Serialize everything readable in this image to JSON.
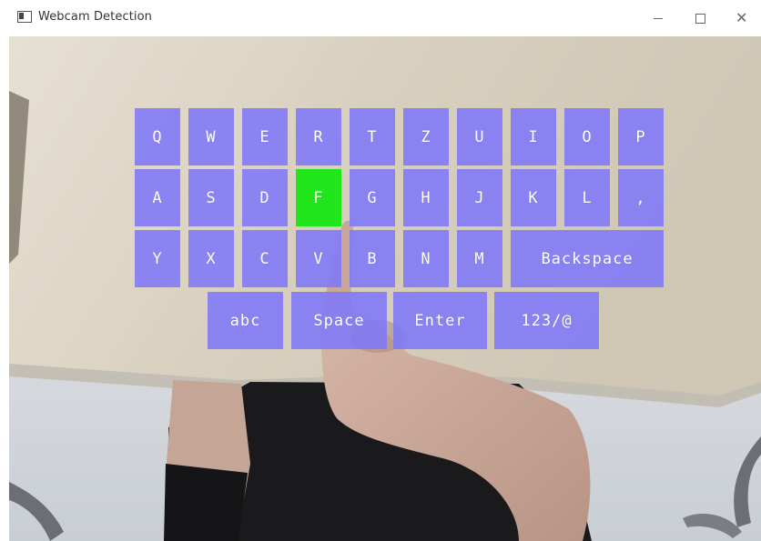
{
  "window": {
    "title": "Webcam Detection",
    "controls": {
      "minimize": "minimize-icon",
      "maximize": "maximize-icon",
      "close": "close-icon"
    }
  },
  "keyboard": {
    "row1": [
      "Q",
      "W",
      "E",
      "R",
      "T",
      "Z",
      "U",
      "I",
      "O",
      "P"
    ],
    "row2": [
      "A",
      "S",
      "D",
      "F",
      "G",
      "H",
      "J",
      "K",
      "L",
      ","
    ],
    "row3": [
      "Y",
      "X",
      "C",
      "V",
      "B",
      "N",
      "M",
      "Backspace"
    ],
    "row4": [
      "abc",
      "Space",
      "Enter",
      "123/@"
    ],
    "active_key": "F",
    "key_color": "#8078f8",
    "active_color": "#22e61c"
  }
}
